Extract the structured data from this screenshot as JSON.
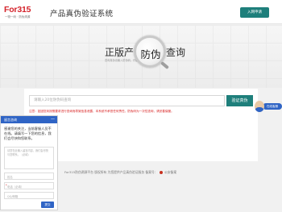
{
  "header": {
    "logo_text": "For315",
    "logo_subtext": "一物一码 · 防伪溯源",
    "title": "产品真伪验证系统",
    "enter_button": "入网申请"
  },
  "hero": {
    "title_left": "正版产品",
    "title_right": "查询",
    "magnifier_text": "防伪",
    "subtitle": "查询真伪请输入防伪码，仔细核对产品真伪信息"
  },
  "search": {
    "placeholder": "请输入20位防伪码查询",
    "button": "验证真伪",
    "warning": "注意：如因您未按照要求进行查询而导致信息泄露，本系统不承担任何责任。防伪码为一次性查询，请妥善保管。"
  },
  "footer": {
    "text": "For315防伪溯源平台 版权所有 为您提供产品真伪验证服务 备案号：",
    "suffix": "公安备案"
  },
  "chat": {
    "title": "留言咨询",
    "minimize": "—",
    "message": "感谢您的关注，当前客服人员不在线。请填写一下您的信息，我们会尽快和您联系。",
    "textarea_placeholder": "请您在此输入留言内容，我们会尽快与您联系。（必填）",
    "fields": [
      "姓名",
      "电话（必填）",
      "QQ/邮箱"
    ],
    "submit": "提交"
  },
  "float_cs": {
    "label": "在线客服"
  },
  "colors": {
    "brand_red": "#d4232b",
    "teal": "#1e7f7b",
    "chat_blue": "#2f64c5",
    "warning_red": "#d71b1b"
  }
}
